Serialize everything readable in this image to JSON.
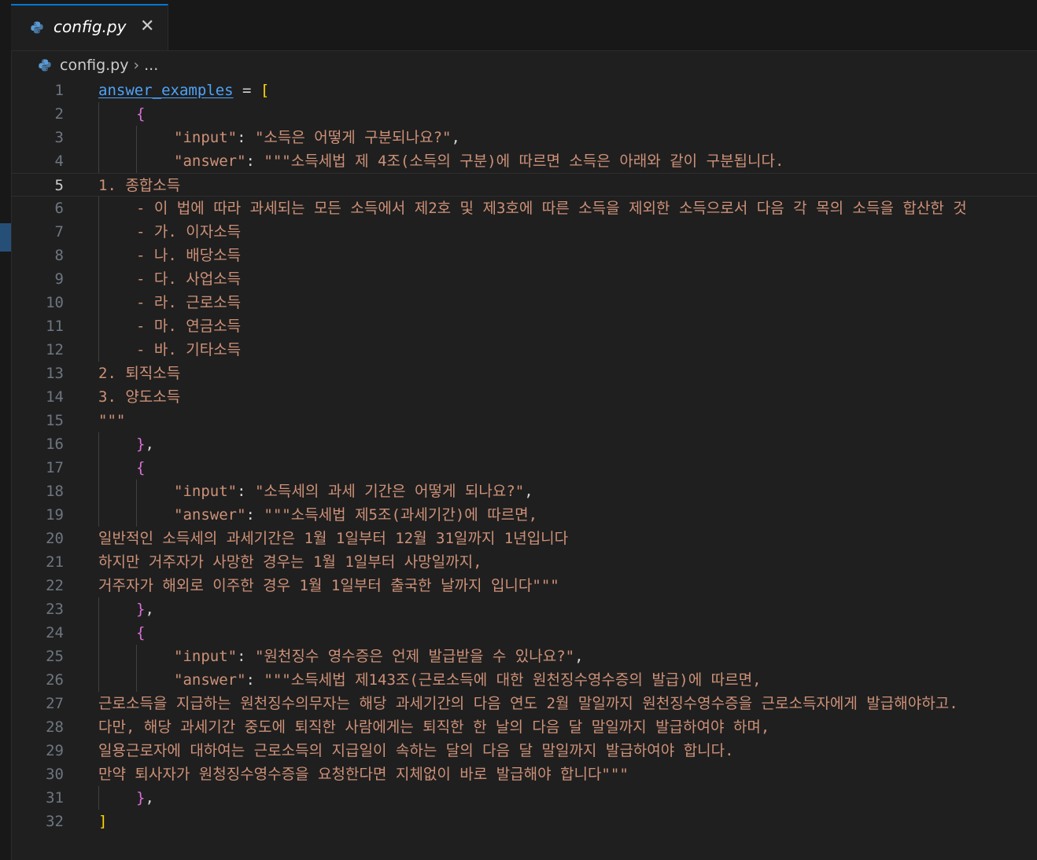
{
  "tab": {
    "filename": "config.py",
    "close_glyph": "✕"
  },
  "breadcrumb": {
    "file": "config.py",
    "separator": "›",
    "more": "..."
  },
  "editor": {
    "current_line": 5,
    "lines": [
      {
        "n": "1",
        "indent": 0,
        "tokens": [
          {
            "t": "answer_examples",
            "c": "var"
          },
          {
            "t": " = ",
            "c": "op"
          },
          {
            "t": "[",
            "c": "br1"
          }
        ]
      },
      {
        "n": "2",
        "indent": 1,
        "tokens": [
          {
            "t": "{",
            "c": "br2"
          }
        ]
      },
      {
        "n": "3",
        "indent": 2,
        "tokens": [
          {
            "t": "\"input\"",
            "c": "str"
          },
          {
            "t": ": ",
            "c": "op"
          },
          {
            "t": "\"소득은 어떻게 구분되나요?\"",
            "c": "str"
          },
          {
            "t": ",",
            "c": "op"
          }
        ]
      },
      {
        "n": "4",
        "indent": 2,
        "tokens": [
          {
            "t": "\"answer\"",
            "c": "str"
          },
          {
            "t": ": ",
            "c": "op"
          },
          {
            "t": "\"\"\"소득세법 제 4조(소득의 구분)에 따르면 소득은 아래와 같이 구분됩니다.",
            "c": "str"
          }
        ]
      },
      {
        "n": "5",
        "indent": 0,
        "tokens": [
          {
            "t": "1. 종합소득",
            "c": "str"
          }
        ]
      },
      {
        "n": "6",
        "indent": 1,
        "tokens": [
          {
            "t": "- 이 법에 따라 과세되는 모든 소득에서 제2호 및 제3호에 따른 소득을 제외한 소득으로서 다음 각 목의 소득을 합산한 것",
            "c": "str"
          }
        ]
      },
      {
        "n": "7",
        "indent": 1,
        "tokens": [
          {
            "t": "- 가. 이자소득",
            "c": "str"
          }
        ]
      },
      {
        "n": "8",
        "indent": 1,
        "tokens": [
          {
            "t": "- 나. 배당소득",
            "c": "str"
          }
        ]
      },
      {
        "n": "9",
        "indent": 1,
        "tokens": [
          {
            "t": "- 다. 사업소득",
            "c": "str"
          }
        ]
      },
      {
        "n": "10",
        "indent": 1,
        "tokens": [
          {
            "t": "- 라. 근로소득",
            "c": "str"
          }
        ]
      },
      {
        "n": "11",
        "indent": 1,
        "tokens": [
          {
            "t": "- 마. 연금소득",
            "c": "str"
          }
        ]
      },
      {
        "n": "12",
        "indent": 1,
        "tokens": [
          {
            "t": "- 바. 기타소득",
            "c": "str"
          }
        ]
      },
      {
        "n": "13",
        "indent": 0,
        "tokens": [
          {
            "t": "2. 퇴직소득",
            "c": "str"
          }
        ]
      },
      {
        "n": "14",
        "indent": 0,
        "tokens": [
          {
            "t": "3. 양도소득",
            "c": "str"
          }
        ]
      },
      {
        "n": "15",
        "indent": 0,
        "tokens": [
          {
            "t": "\"\"\"",
            "c": "str"
          }
        ]
      },
      {
        "n": "16",
        "indent": 1,
        "tokens": [
          {
            "t": "}",
            "c": "br2"
          },
          {
            "t": ",",
            "c": "op"
          }
        ]
      },
      {
        "n": "17",
        "indent": 1,
        "tokens": [
          {
            "t": "{",
            "c": "br2"
          }
        ]
      },
      {
        "n": "18",
        "indent": 2,
        "tokens": [
          {
            "t": "\"input\"",
            "c": "str"
          },
          {
            "t": ": ",
            "c": "op"
          },
          {
            "t": "\"소득세의 과세 기간은 어떻게 되나요?\"",
            "c": "str"
          },
          {
            "t": ",",
            "c": "op"
          }
        ]
      },
      {
        "n": "19",
        "indent": 2,
        "tokens": [
          {
            "t": "\"answer\"",
            "c": "str"
          },
          {
            "t": ": ",
            "c": "op"
          },
          {
            "t": "\"\"\"소득세법 제5조(과세기간)에 따르면,",
            "c": "str"
          }
        ]
      },
      {
        "n": "20",
        "indent": 0,
        "tokens": [
          {
            "t": "일반적인 소득세의 과세기간은 1월 1일부터 12월 31일까지 1년입니다",
            "c": "str"
          }
        ]
      },
      {
        "n": "21",
        "indent": 0,
        "tokens": [
          {
            "t": "하지만 거주자가 사망한 경우는 1월 1일부터 사망일까지,",
            "c": "str"
          }
        ]
      },
      {
        "n": "22",
        "indent": 0,
        "tokens": [
          {
            "t": "거주자가 해외로 이주한 경우 1월 1일부터 출국한 날까지 입니다\"\"\"",
            "c": "str"
          }
        ]
      },
      {
        "n": "23",
        "indent": 1,
        "tokens": [
          {
            "t": "}",
            "c": "br2"
          },
          {
            "t": ",",
            "c": "op"
          }
        ]
      },
      {
        "n": "24",
        "indent": 1,
        "tokens": [
          {
            "t": "{",
            "c": "br2"
          }
        ]
      },
      {
        "n": "25",
        "indent": 2,
        "tokens": [
          {
            "t": "\"input\"",
            "c": "str"
          },
          {
            "t": ": ",
            "c": "op"
          },
          {
            "t": "\"원천징수 영수증은 언제 발급받을 수 있나요?\"",
            "c": "str"
          },
          {
            "t": ",",
            "c": "op"
          }
        ]
      },
      {
        "n": "26",
        "indent": 2,
        "tokens": [
          {
            "t": "\"answer\"",
            "c": "str"
          },
          {
            "t": ": ",
            "c": "op"
          },
          {
            "t": "\"\"\"소득세법 제143조(근로소득에 대한 원천징수영수증의 발급)에 따르면,",
            "c": "str"
          }
        ]
      },
      {
        "n": "27",
        "indent": 0,
        "tokens": [
          {
            "t": "근로소득을 지급하는 원천징수의무자는 해당 과세기간의 다음 연도 2월 말일까지 원천징수영수증을 근로소득자에게 발급해야하고.",
            "c": "str"
          }
        ]
      },
      {
        "n": "28",
        "indent": 0,
        "tokens": [
          {
            "t": "다만, 해당 과세기간 중도에 퇴직한 사람에게는 퇴직한 한 날의 다음 달 말일까지 발급하여야 하며,",
            "c": "str"
          }
        ]
      },
      {
        "n": "29",
        "indent": 0,
        "tokens": [
          {
            "t": "일용근로자에 대하여는 근로소득의 지급일이 속하는 달의 다음 달 말일까지 발급하여야 합니다.",
            "c": "str"
          }
        ]
      },
      {
        "n": "30",
        "indent": 0,
        "tokens": [
          {
            "t": "만약 퇴사자가 원청징수영수증을 요청한다면 지체없이 바로 발급해야 합니다\"\"\"",
            "c": "str"
          }
        ]
      },
      {
        "n": "31",
        "indent": 1,
        "tokens": [
          {
            "t": "}",
            "c": "br2"
          },
          {
            "t": ",",
            "c": "op"
          }
        ]
      },
      {
        "n": "32",
        "indent": 0,
        "tokens": [
          {
            "t": "]",
            "c": "br1"
          }
        ]
      }
    ]
  }
}
